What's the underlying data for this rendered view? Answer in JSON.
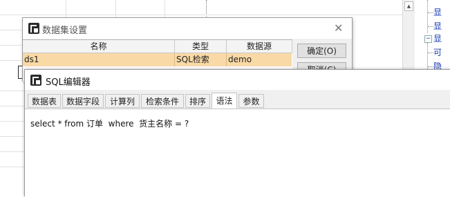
{
  "dataset_dialog": {
    "title": "数据集设置",
    "columns": [
      "名称",
      "类型",
      "数据源"
    ],
    "rows": [
      {
        "name": "ds1",
        "type": "SQL检索",
        "source": "demo"
      }
    ],
    "ok_label": "确定(O)",
    "cancel_label": "取消(C)"
  },
  "sql_editor": {
    "title": "SQL编辑器",
    "tabs": [
      "数据表",
      "数据字段",
      "计算列",
      "检索条件",
      "排序",
      "语法",
      "参数"
    ],
    "active_tab": "语法",
    "query": "select * from 订单  where  货主名称 = ?"
  },
  "tree_panel": {
    "items": [
      "显",
      "显",
      "显",
      "可",
      "隐"
    ]
  }
}
